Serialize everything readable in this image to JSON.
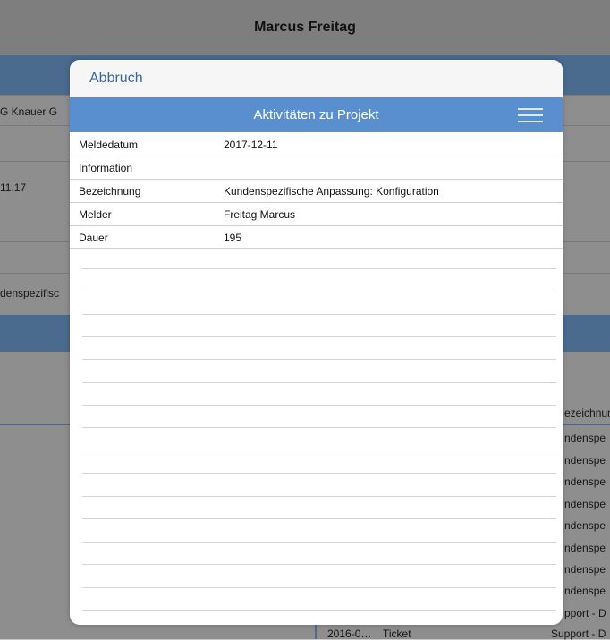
{
  "background": {
    "title": "Marcus Freitag",
    "left_fragments": [
      "G Knauer G",
      "11.17",
      "denspezifisc"
    ],
    "right_header": "ezeichnun",
    "right_rows": [
      "ndenspe",
      "ndenspe",
      "ndenspe",
      "ndenspe",
      "ndenspe",
      "ndenspe",
      "ndenspe",
      "ndenspe",
      "pport - D"
    ],
    "bottom_row": {
      "date": "2016-0…",
      "type": "Ticket",
      "desc": "Support - D"
    }
  },
  "modal": {
    "cancel_label": "Abbruch",
    "header_title": "Aktivitäten zu Projekt",
    "menu_icon": "hamburger-menu-icon",
    "rows": [
      {
        "label": "Meldedatum",
        "value": "2017-12-11"
      },
      {
        "label": "Information",
        "value": ""
      },
      {
        "label": "Bezeichnung",
        "value": "Kundenspezifische Anpassung: Konfiguration"
      },
      {
        "label": "Melder",
        "value": "Freitag Marcus"
      },
      {
        "label": "Dauer",
        "value": "195"
      }
    ]
  },
  "colors": {
    "accent": "#5a8fcf",
    "cancel_text": "#3a6699",
    "dim_background": "#8e8e8e"
  }
}
